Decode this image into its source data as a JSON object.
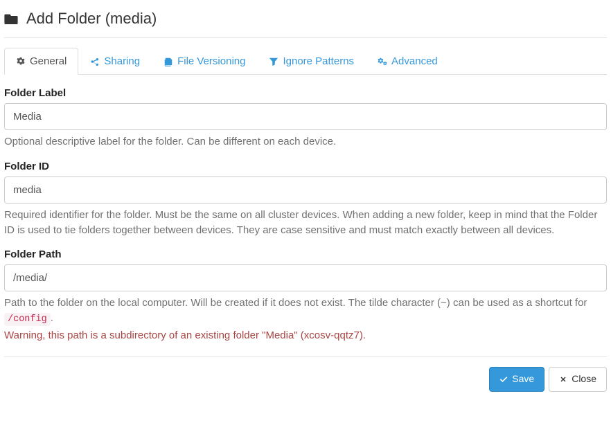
{
  "header": {
    "title": "Add Folder (media)"
  },
  "tabs": {
    "general": "General",
    "sharing": "Sharing",
    "file_versioning": "File Versioning",
    "ignore_patterns": "Ignore Patterns",
    "advanced": "Advanced"
  },
  "form": {
    "folder_label": {
      "label": "Folder Label",
      "value": "Media",
      "help": "Optional descriptive label for the folder. Can be different on each device."
    },
    "folder_id": {
      "label": "Folder ID",
      "value": "media",
      "help": "Required identifier for the folder. Must be the same on all cluster devices. When adding a new folder, keep in mind that the Folder ID is used to tie folders together between devices. They are case sensitive and must match exactly between all devices."
    },
    "folder_path": {
      "label": "Folder Path",
      "value": "/media/",
      "help_prefix": "Path to the folder on the local computer. Will be created if it does not exist. The tilde character (~) can be used as a shortcut for ",
      "help_code": "/config",
      "help_suffix": ".",
      "warning": "Warning, this path is a subdirectory of an existing folder \"Media\" (xcosv-qqtz7)."
    }
  },
  "footer": {
    "save": "Save",
    "close": "Close"
  }
}
